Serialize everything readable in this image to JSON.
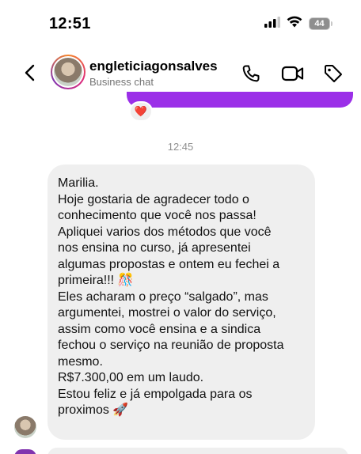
{
  "status_bar": {
    "time": "12:51",
    "battery_level": "44",
    "icons": [
      "signal-icon",
      "wifi-icon",
      "battery-icon"
    ]
  },
  "header": {
    "back_icon": "chevron-left-icon",
    "username": "engleticiagonsalves",
    "subtitle": "Business chat",
    "actions": [
      "phone-icon",
      "video-camera-icon",
      "tag-icon"
    ]
  },
  "thread": {
    "previous_reaction": "❤️",
    "timestamp": "12:45",
    "message": {
      "lines": [
        "Marilia.",
        "Hoje gostaria de agradecer todo o",
        "conhecimento que você nos passa!",
        "Apliquei varios dos métodos que você",
        "nos ensina no curso, já apresentei",
        "algumas propostas e ontem eu fechei a",
        "primeira!!! 🎊",
        "Eles acharam o preço “salgado”, mas",
        "argumentei, mostrei o valor do serviço,",
        "assim como você ensina e a sindica",
        "fechou o serviço na reunião de proposta",
        "mesmo.",
        "R$7.300,00 em um laudo.",
        "Estou feliz e já empolgada para os",
        "proximos 🚀"
      ]
    }
  },
  "colors": {
    "accent_purple": "#9b2fe8",
    "bubble_gray": "#efefef",
    "muted_text": "#737373"
  }
}
